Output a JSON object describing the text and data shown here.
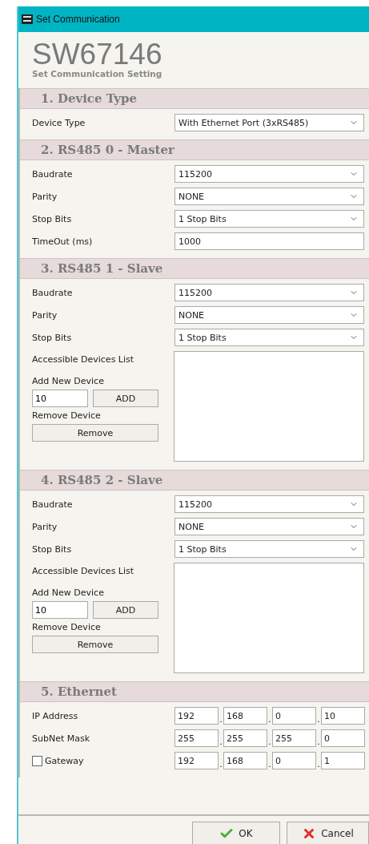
{
  "window": {
    "title": "Set Communication"
  },
  "header": {
    "title": "SW67146",
    "subtitle": "Set Communication Setting"
  },
  "sections": [
    {
      "title": "1. Device Type",
      "rows": [
        {
          "kind": "select",
          "label": "Device Type",
          "value": "With Ethernet Port (3xRS485)"
        }
      ]
    },
    {
      "title": "2. RS485 0 - Master",
      "rows": [
        {
          "kind": "select",
          "label": "Baudrate",
          "value": "115200"
        },
        {
          "kind": "select",
          "label": "Parity",
          "value": "NONE"
        },
        {
          "kind": "select",
          "label": "Stop Bits",
          "value": "1 Stop Bits"
        },
        {
          "kind": "input",
          "label": "TimeOut (ms)",
          "value": "1000"
        }
      ]
    },
    {
      "title": "3. RS485 1 - Slave",
      "rows": [
        {
          "kind": "select",
          "label": "Baudrate",
          "value": "115200"
        },
        {
          "kind": "select",
          "label": "Parity",
          "value": "NONE"
        },
        {
          "kind": "select",
          "label": "Stop Bits",
          "value": "1 Stop Bits"
        },
        {
          "kind": "devices",
          "list_label": "Accessible Devices List",
          "add_label": "Add New Device",
          "add_value": "10",
          "add_button": "ADD",
          "remove_label": "Remove Device",
          "remove_button": "Remove"
        }
      ]
    },
    {
      "title": "4. RS485 2 - Slave",
      "rows": [
        {
          "kind": "select",
          "label": "Baudrate",
          "value": "115200"
        },
        {
          "kind": "select",
          "label": "Parity",
          "value": "NONE"
        },
        {
          "kind": "select",
          "label": "Stop Bits",
          "value": "1 Stop Bits"
        },
        {
          "kind": "devices",
          "list_label": "Accessible Devices List",
          "add_label": "Add New Device",
          "add_value": "10",
          "add_button": "ADD",
          "remove_label": "Remove Device",
          "remove_button": "Remove"
        }
      ]
    },
    {
      "title": "5. Ethernet",
      "rows": [
        {
          "kind": "ip",
          "label": "IP Address",
          "octets": [
            "192",
            "168",
            "0",
            "10"
          ],
          "separators": [
            ".",
            ".",
            "."
          ]
        },
        {
          "kind": "ip",
          "label": "SubNet Mask",
          "octets": [
            "255",
            "255",
            "255",
            "0"
          ],
          "separators": [
            ".",
            ".",
            "."
          ]
        },
        {
          "kind": "ip_check",
          "label": "Gateway",
          "checked": false,
          "octets": [
            "192",
            "168",
            "0",
            "1"
          ],
          "separators": [
            ".",
            ".",
            "."
          ]
        }
      ]
    }
  ],
  "buttons": [
    {
      "kind": "ok",
      "label": "OK"
    },
    {
      "kind": "cancel",
      "label": "Cancel"
    }
  ]
}
